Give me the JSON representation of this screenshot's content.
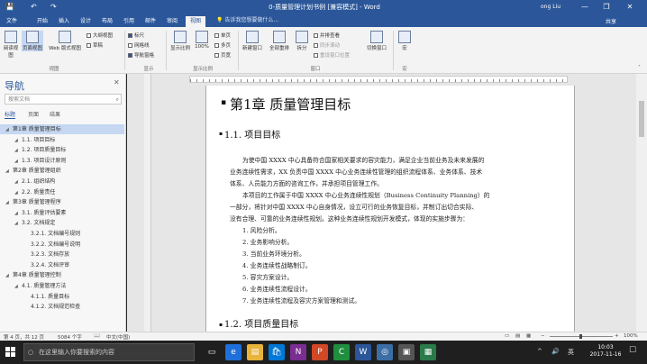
{
  "app": {
    "title": "0-质量管理计划书例 [兼容模式] - Word",
    "user": "ong Liu",
    "quick_access": [
      "save-icon",
      "undo-icon",
      "redo-icon"
    ],
    "window_controls": [
      "—",
      "❐",
      "✕"
    ]
  },
  "ribbon": {
    "tabs": [
      "文件",
      "开始",
      "插入",
      "设计",
      "布局",
      "引用",
      "邮件",
      "审阅",
      "视图"
    ],
    "active_tab": "视图",
    "tell_me": "告诉我您想要做什么...",
    "share": "共享",
    "views": {
      "read": "阅读视图",
      "print": "页面视图",
      "web": "Web 版式视图",
      "outline": "大纲视图",
      "draft": "草稿"
    },
    "show": {
      "ruler": "标尺",
      "gridlines": "网格线",
      "nav_pane": "导航窗格"
    },
    "zoom": {
      "zoom": "显示比例",
      "percent": "100%",
      "one_page": "单页",
      "multi_page": "多页",
      "page_width": "页宽"
    },
    "window": {
      "new": "新建窗口",
      "arrange": "全部重排",
      "split": "拆分",
      "side_by_side": "并排查看",
      "sync_scroll": "同步滚动",
      "reset_pos": "重设窗口位置",
      "switch": "切换窗口"
    },
    "macros": "宏",
    "groups": {
      "views": "视图",
      "show": "显示",
      "zoom": "显示比例",
      "window": "窗口",
      "macros": "宏"
    }
  },
  "nav": {
    "title": "导航",
    "search_placeholder": "搜索文档",
    "tabs": [
      "标题",
      "页面",
      "结果"
    ],
    "headings": [
      {
        "text": "第1章 质量管理目标",
        "level": 0,
        "selected": true
      },
      {
        "text": "1.1. 项目目标",
        "level": 1,
        "selected": false
      },
      {
        "text": "1.2. 项目质量目标",
        "level": 1,
        "selected": false
      },
      {
        "text": "1.3. 项目设计原则",
        "level": 1,
        "selected": false
      },
      {
        "text": "第2章 质量管理组织",
        "level": 0,
        "selected": false
      },
      {
        "text": "2.1. 组织结构",
        "level": 1,
        "selected": false
      },
      {
        "text": "2.2. 质量责任",
        "level": 1,
        "selected": false
      },
      {
        "text": "第3章 质量管理程序",
        "level": 0,
        "selected": false
      },
      {
        "text": "3.1. 质量评估要素",
        "level": 1,
        "selected": false
      },
      {
        "text": "3.2. 文档规定",
        "level": 1,
        "selected": false
      },
      {
        "text": "3.2.1. 文档编号规则",
        "level": 2,
        "selected": false
      },
      {
        "text": "3.2.2. 文档编号说明",
        "level": 2,
        "selected": false
      },
      {
        "text": "3.2.3. 文档存放",
        "level": 2,
        "selected": false
      },
      {
        "text": "3.2.4. 文档评审",
        "level": 2,
        "selected": false
      },
      {
        "text": "第4章 质量管理控制",
        "level": 0,
        "selected": false
      },
      {
        "text": "4.1. 质量管理方法",
        "level": 1,
        "selected": false
      },
      {
        "text": "4.1.1. 质量目标",
        "level": 2,
        "selected": false
      },
      {
        "text": "4.1.2. 文档规范检查",
        "level": 2,
        "selected": false
      }
    ]
  },
  "document": {
    "chapter_title": "第1章 质量管理目标",
    "section1_title": "1.1. 项目目标",
    "para1": [
      "为使中国 XXXX 中心具备符合国家相关要求的容灾能力，满足企业当前业务及未来发展的",
      "业务连续性需求，XX 负责中国 XXXX 中心业务连续性管理的组织流程体系、业务体系、技术",
      "体系、人员能力方面的咨询工作，并承担项目管理工作。"
    ],
    "para2": [
      "本项目的工作属于中国 XXXX 中心业务连续性规划（Business Continuity Planning）的",
      "一部分，将针对中国 XXXX 中心自身情况，设立可行的业务恢复目标，并制订出切合实际、",
      "没有合理、可靠的业务连续性规划。这种业务连续性规划开发模式，体现的实施步骤为："
    ],
    "list": [
      "1. 风险分析。",
      "2. 业务影响分析。",
      "3. 当前业务环境分析。",
      "4. 业务连续性战略制订。",
      "5. 容灾方案设计。",
      "6. 业务连续性流程设计。",
      "7. 业务连续性流程及容灾方案管理和测试。"
    ],
    "section2_title": "1.2. 项目质量目标"
  },
  "status": {
    "page": "第 4 页，共 12 页",
    "words": "5084 个字",
    "language": "中文(中国)",
    "zoom": "100%"
  },
  "taskbar": {
    "search": "在这里输入你要搜索的内容",
    "time": "10:03",
    "date": "2017-11-16",
    "apps": [
      {
        "name": "task-view-icon",
        "color": "#1f1f1f",
        "glyph": "▭"
      },
      {
        "name": "edge-icon",
        "color": "#1e6fd9",
        "glyph": "e"
      },
      {
        "name": "explorer-icon",
        "color": "#e8b43a",
        "glyph": "▤"
      },
      {
        "name": "store-icon",
        "color": "#0078d7",
        "glyph": "🛍"
      },
      {
        "name": "onenote-icon",
        "color": "#7b2e91",
        "glyph": "N"
      },
      {
        "name": "powerpoint-icon",
        "color": "#d24726",
        "glyph": "P"
      },
      {
        "name": "green-app-icon",
        "color": "#1f8f3e",
        "glyph": "C"
      },
      {
        "name": "word-icon",
        "color": "#2b579a",
        "glyph": "W"
      },
      {
        "name": "app9-icon",
        "color": "#3b6ea5",
        "glyph": "◎"
      },
      {
        "name": "app10-icon",
        "color": "#555",
        "glyph": "▣"
      },
      {
        "name": "app11-icon",
        "color": "#2a7a4a",
        "glyph": "▦"
      }
    ],
    "tray": [
      "^",
      "🔊",
      "英"
    ]
  }
}
